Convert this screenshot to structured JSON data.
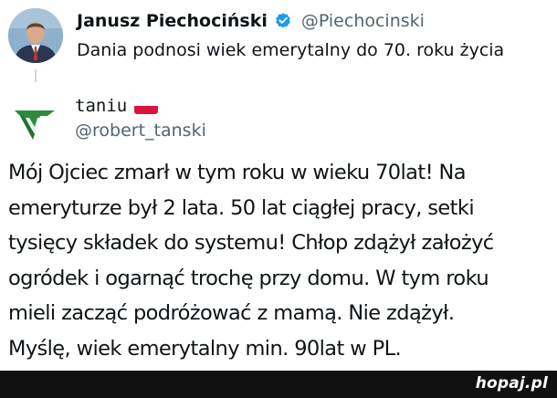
{
  "parent_tweet": {
    "author_name": "Janusz Piechociński",
    "handle": "@Piechocinski",
    "verified_icon": "verified-badge-icon",
    "text": "Dania podnosi wiek emerytalny do 70. roku życia"
  },
  "reply_tweet": {
    "author_name": "taniu",
    "flag_icon": "poland-flag-icon",
    "handle": "@robert_tanski",
    "lines": [
      "Mój Ojciec zmarł w tym roku w wieku 70lat! Na",
      "emeryturze był 2 lata. 50 lat ciągłej pracy, setki",
      "tysięcy składek do systemu! Chłop zdążył założyć",
      "ogródek i ogarnąć trochę przy domu. W tym roku",
      "mieli zacząć podróżować z mamą. Nie zdążył.",
      "Myślę, wiek emerytalny min. 90lat w PL."
    ]
  },
  "watermark": {
    "text": "hopaj.pl"
  },
  "colors": {
    "text": "#0f1419",
    "secondary_text": "#536471",
    "verified_blue": "#1d9bf0",
    "avatar_logo_green": "#2e8b3e",
    "watermark_bar": "#111111"
  }
}
